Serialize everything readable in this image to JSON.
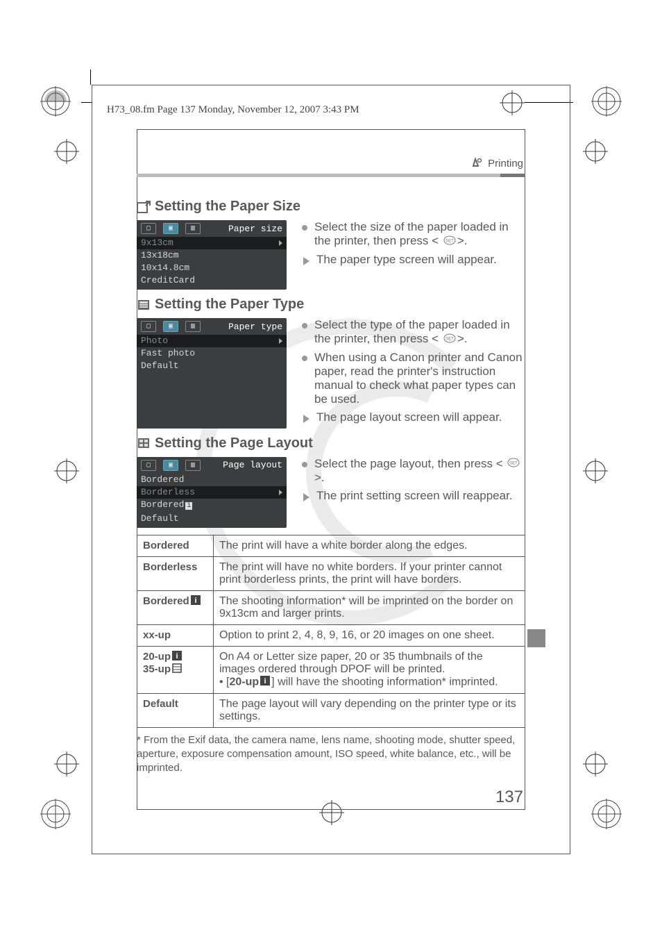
{
  "header": {
    "running": "H73_08.fm  Page 137  Monday, November 12, 2007  3:43 PM",
    "section_label": "Printing"
  },
  "sections": {
    "size": {
      "title": "Setting the Paper Size",
      "lcd_title": "Paper size",
      "items": [
        "9x13cm",
        "13x18cm",
        "10x14.8cm",
        "CreditCard"
      ],
      "bullets": [
        "Select the size of the paper loaded in the printer, then press <",
        ">."
      ],
      "arrows": [
        "The paper type screen will appear."
      ]
    },
    "type": {
      "title": "Setting the Paper Type",
      "lcd_title": "Paper type",
      "items": [
        "Photo",
        "Fast photo",
        "Default"
      ],
      "bullets": [
        "Select the type of the paper loaded in the printer, then press <",
        ">.",
        "When using a Canon printer and Canon paper, read the printer's instruction manual to check what paper types can be used."
      ],
      "arrows": [
        "The page layout screen will appear."
      ]
    },
    "layout": {
      "title": "Setting the Page Layout",
      "lcd_title": "Page layout",
      "items": [
        "Bordered",
        "Borderless",
        "Bordered",
        "Default"
      ],
      "bullets": [
        "Select the page layout, then press <",
        ">."
      ],
      "arrows": [
        "The print setting screen will reappear."
      ]
    }
  },
  "table": {
    "rows": [
      {
        "label": "Bordered",
        "desc": "The print will have a white border along the edges."
      },
      {
        "label": "Borderless",
        "desc": "The print will have no white borders. If your printer cannot print borderless prints, the print will have borders."
      },
      {
        "label": "Bordered",
        "icon": "info",
        "desc": "The shooting information* will be imprinted on the border on 9x13cm and larger prints."
      },
      {
        "label": "xx-up",
        "desc": "Option to print 2, 4, 8, 9, 16, or 20 images on one sheet."
      },
      {
        "label": "20-up",
        "label2": "35-up",
        "icon": "info",
        "icon2": "sheet",
        "desc": "On A4 or Letter size paper, 20 or 35 thumbnails of the images ordered through DPOF will be printed.",
        "desc2a": "• [",
        "desc2b": "20-up",
        "desc2c": "] will have the shooting information* imprinted."
      },
      {
        "label": "Default",
        "desc": "The page layout will vary depending on the printer type or its settings."
      }
    ]
  },
  "footnote": "* From the Exif data, the camera name, lens name, shooting mode, shutter speed, aperture, exposure compensation amount, ISO speed, white balance, etc., will be imprinted.",
  "page_number": "137"
}
